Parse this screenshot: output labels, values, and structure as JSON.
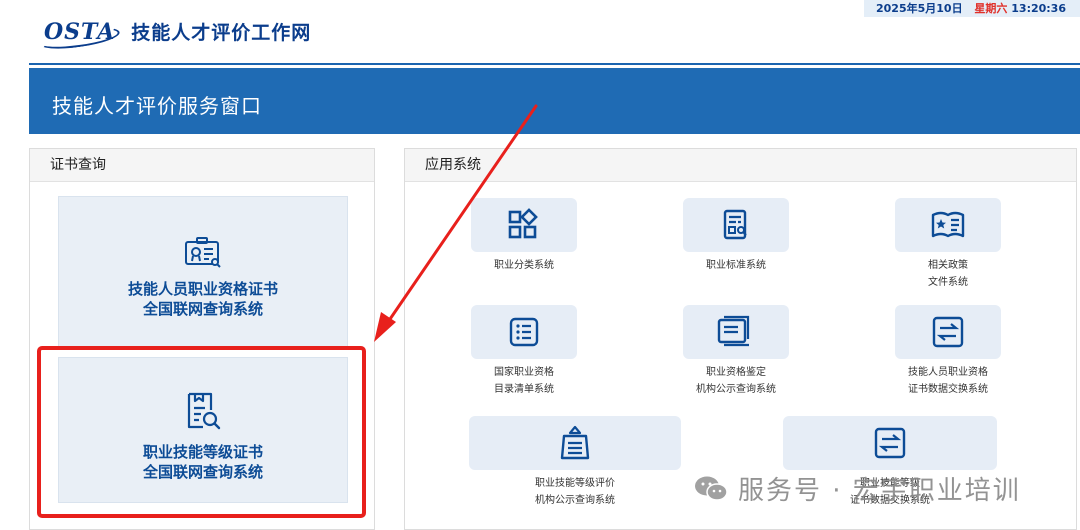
{
  "header": {
    "logo_text": "OSTA",
    "site_title": "技能人才评价工作网",
    "date": "2025年5月10日",
    "weekday": "星期六",
    "time": "13:20:36"
  },
  "banner": {
    "title": "技能人才评价服务窗口"
  },
  "cert_query": {
    "heading": "证书查询",
    "cards": [
      {
        "line1": "技能人员职业资格证书",
        "line2": "全国联网查询系统",
        "icon": "certificate-icon"
      },
      {
        "line1": "职业技能等级证书",
        "line2": "全国联网查询系统",
        "icon": "document-search-icon"
      }
    ]
  },
  "app_systems": {
    "heading": "应用系统",
    "items": [
      {
        "label": "职业分类系统",
        "icon": "category-grid-icon"
      },
      {
        "label": "职业标准系统",
        "icon": "standard-document-icon"
      },
      {
        "label": "相关政策\n文件系统",
        "icon": "policy-book-icon"
      },
      {
        "label": "国家职业资格\n目录清单系统",
        "icon": "list-icon"
      },
      {
        "label": "职业资格鉴定\n机构公示查询系统",
        "icon": "stacked-documents-icon"
      },
      {
        "label": "技能人员职业资格\n证书数据交换系统",
        "icon": "exchange-icon"
      },
      {
        "label": "职业技能等级评价\n机构公示查询系统",
        "icon": "announcement-icon"
      },
      {
        "label": "职业技能等级\n证书数据交换系统",
        "icon": "exchange-icon"
      }
    ]
  },
  "watermark": {
    "text": "服务号 · 宏宇职业培训"
  },
  "colors": {
    "brand_blue": "#1f6bb4",
    "title_blue": "#0d4c96",
    "annotation_red": "#e8201c",
    "tile_bg": "#e6edf6"
  }
}
